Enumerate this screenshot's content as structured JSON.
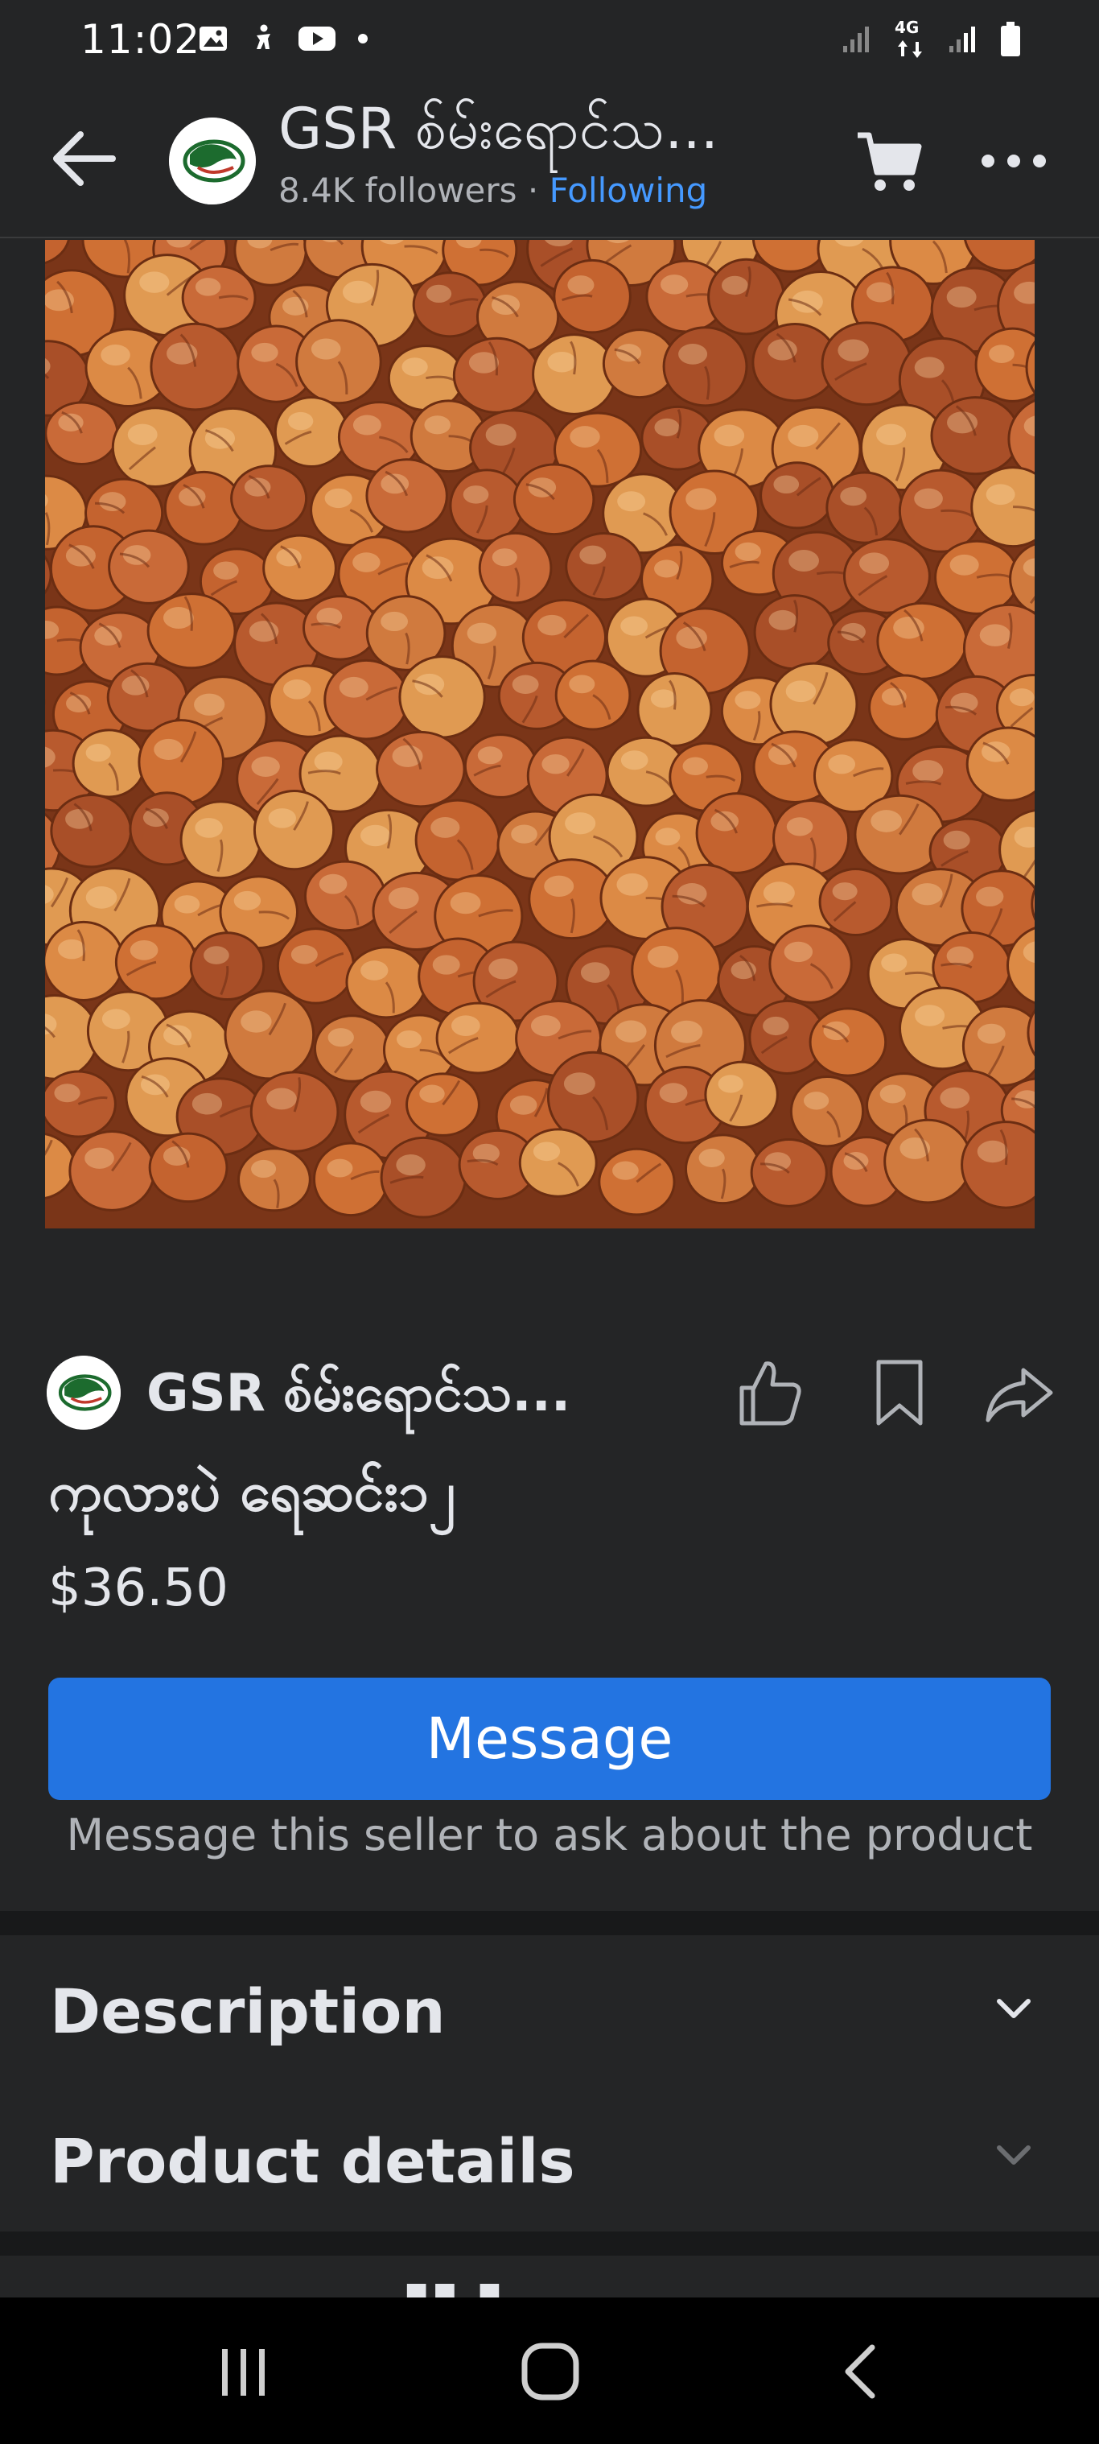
{
  "status_bar": {
    "time": "11:02",
    "left_icons": [
      "gallery-icon",
      "accessibility-icon",
      "youtube-icon",
      "dot-icon"
    ],
    "network_label": "4G"
  },
  "header": {
    "page_name": "GSR စ်မ်းရောင်သ...",
    "followers": "8.4K followers",
    "separator": " · ",
    "follow_status": "Following"
  },
  "seller": {
    "name": "GSR စ်မ်းရောင်သ..."
  },
  "product": {
    "title": "ကုလားပဲ ရေဆင်း၁၂",
    "price": "$36.50"
  },
  "actions": {
    "message_label": "Message",
    "message_hint": "Message this seller to ask about the product"
  },
  "sections": [
    {
      "label": "Description"
    },
    {
      "label": "Product details"
    }
  ],
  "colors": {
    "background": "#242526",
    "accent": "#2374e1",
    "link": "#4599ff",
    "divider": "#18191a"
  }
}
